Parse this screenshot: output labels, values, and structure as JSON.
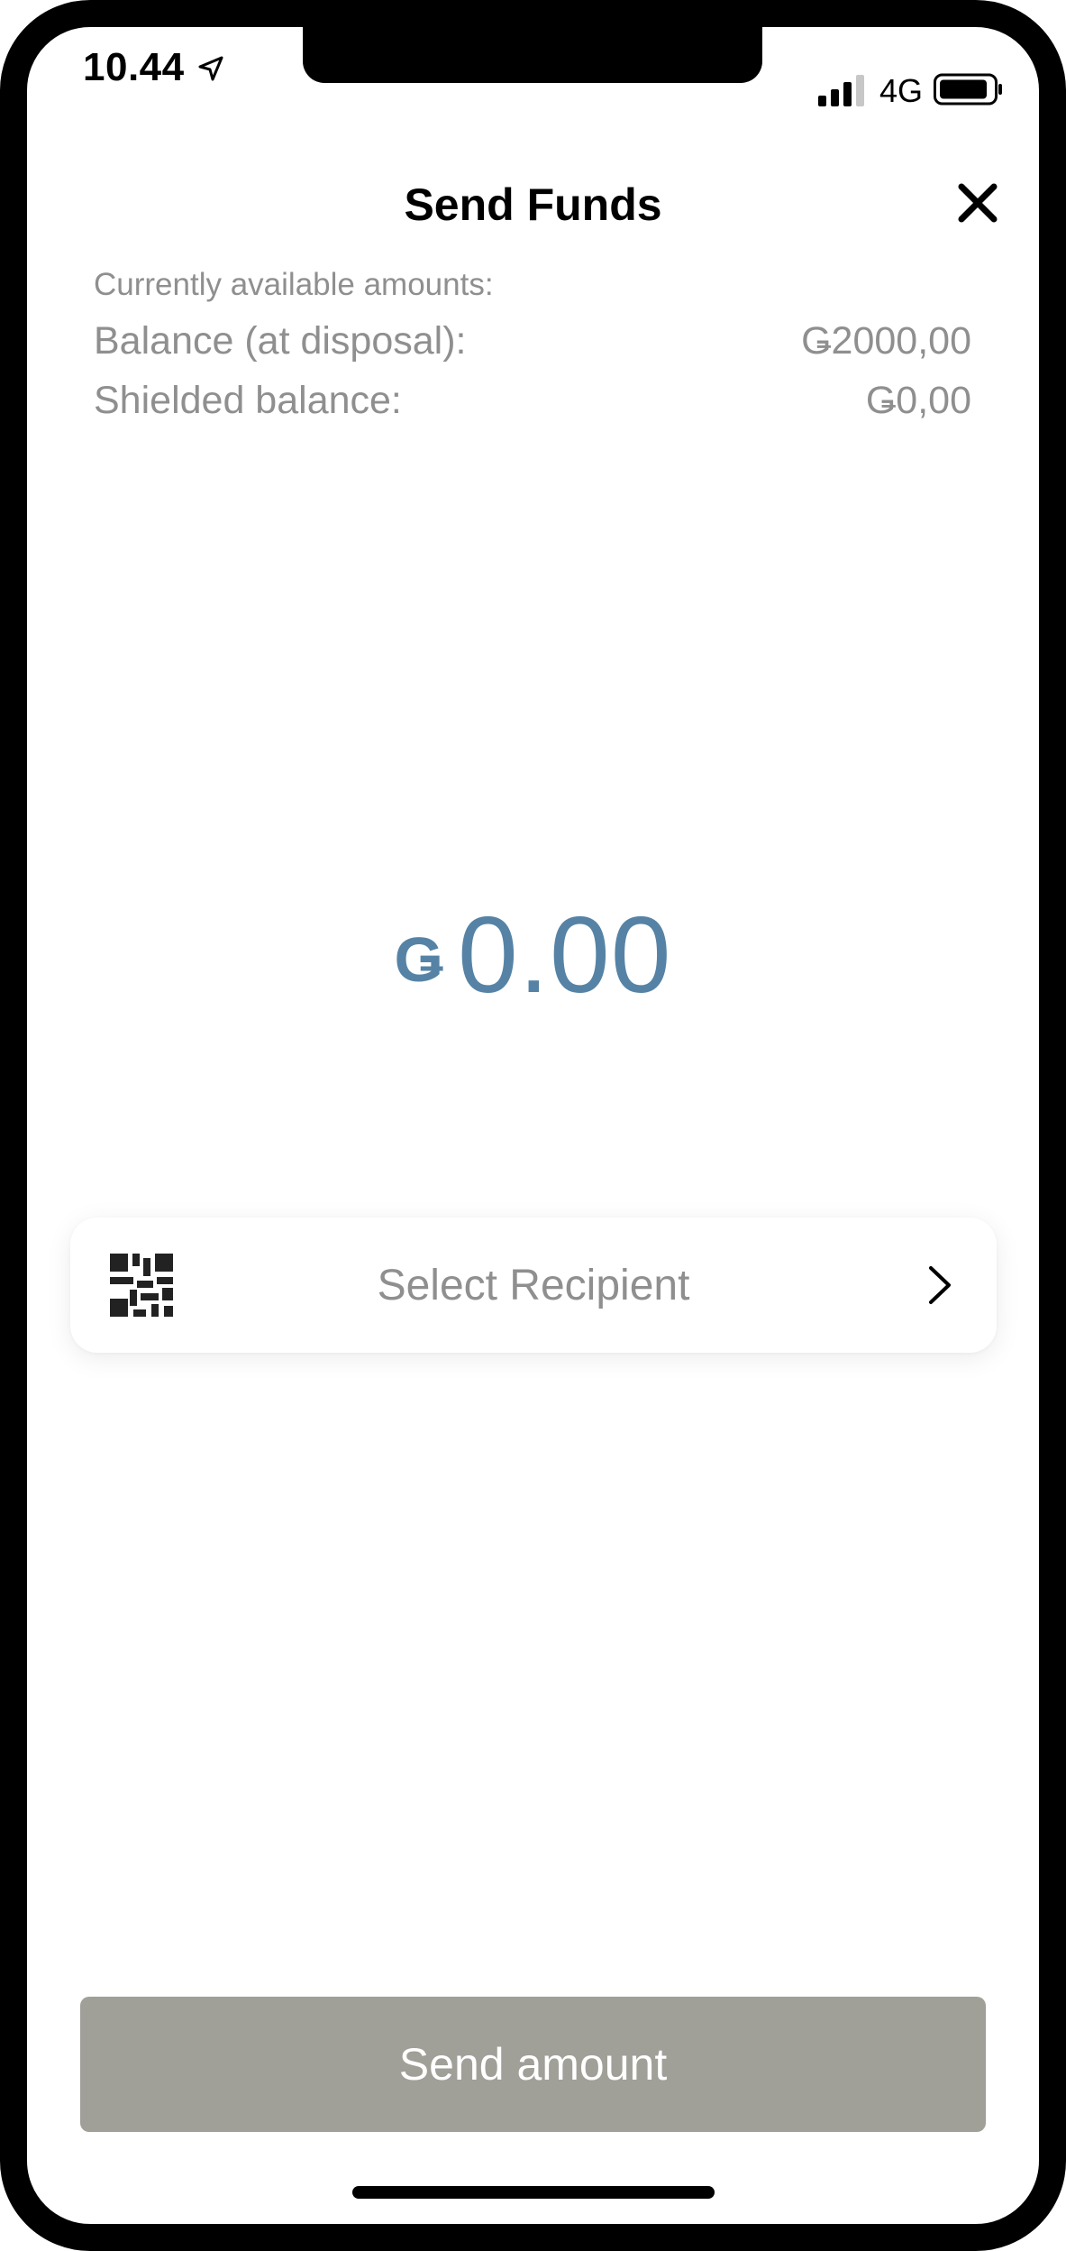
{
  "status_bar": {
    "time": "10.44",
    "network": "4G",
    "icons": [
      "location-arrow-icon",
      "signal-bars-icon",
      "battery-icon"
    ]
  },
  "header": {
    "title": "Send Funds",
    "close_icon": "close-icon"
  },
  "balances": {
    "label": "Currently available amounts:",
    "rows": [
      {
        "label": "Balance (at disposal):",
        "value": "Ǥ2000,00"
      },
      {
        "label": "Shielded balance:",
        "value": "Ǥ0,00"
      }
    ]
  },
  "amount": {
    "currency_symbol": "Ǥ",
    "value": "0.00",
    "color": "#5683a5"
  },
  "recipient": {
    "label": "Select Recipient",
    "icon": "qr-code-icon",
    "chevron": "chevron-right-icon"
  },
  "footer": {
    "send_label": "Send amount",
    "button_color": "#a09f98"
  }
}
